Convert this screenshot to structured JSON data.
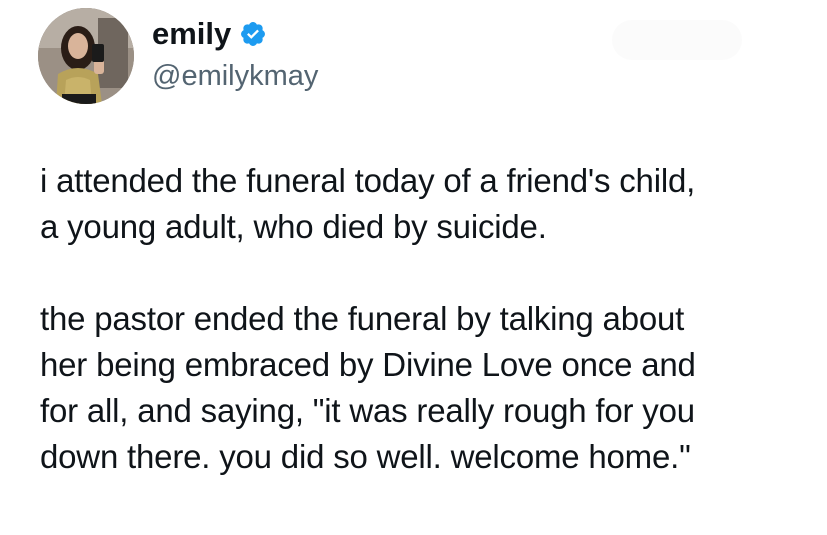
{
  "author": {
    "display_name": "emily",
    "handle": "@emilykmay",
    "verified": true,
    "verified_badge_icon": "verified-badge-icon",
    "avatar_icon": "profile-avatar",
    "accent_color": "#1d9bf0"
  },
  "tweet": {
    "paragraph_1": [
      "i attended the funeral today of a friend's child,",
      "a young adult, who died by suicide."
    ],
    "paragraph_2": [
      "the pastor ended the funeral by talking about",
      "her being embraced by Divine Love once and",
      "for all, and saying, \"it was really rough for you",
      "down there. you did so well. welcome home.\""
    ]
  }
}
